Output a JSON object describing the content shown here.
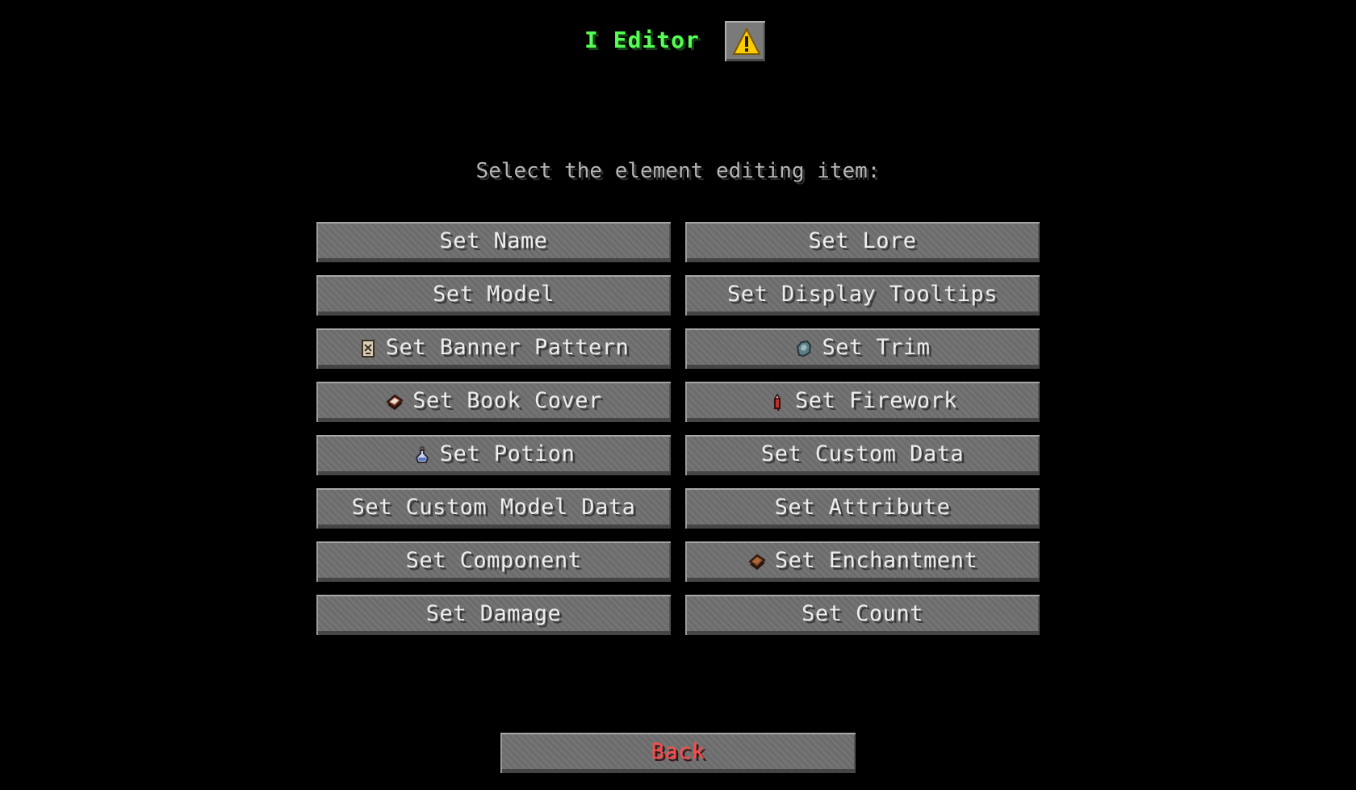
{
  "header": {
    "title": "I Editor",
    "warning_icon": "warning-icon"
  },
  "subtitle": "Select the element editing item:",
  "buttons": [
    {
      "label": "Set Name",
      "icon": null
    },
    {
      "label": "Set Lore",
      "icon": null
    },
    {
      "label": "Set Model",
      "icon": null
    },
    {
      "label": "Set Display Tooltips",
      "icon": null
    },
    {
      "label": "Set Banner Pattern",
      "icon": "banner-pattern-icon"
    },
    {
      "label": "Set Trim",
      "icon": "armor-trim-icon"
    },
    {
      "label": "Set Book Cover",
      "icon": "book-icon"
    },
    {
      "label": "Set Firework",
      "icon": "firework-rocket-icon"
    },
    {
      "label": "Set Potion",
      "icon": "potion-icon"
    },
    {
      "label": "Set Custom Data",
      "icon": null
    },
    {
      "label": "Set Custom Model Data",
      "icon": null
    },
    {
      "label": "Set Attribute",
      "icon": null
    },
    {
      "label": "Set Component",
      "icon": null
    },
    {
      "label": "Set Enchantment",
      "icon": "enchanted-book-icon"
    },
    {
      "label": "Set Damage",
      "icon": null
    },
    {
      "label": "Set Count",
      "icon": null
    }
  ],
  "back_button": {
    "label": "Back"
  },
  "colors": {
    "title": "#55ff55",
    "back_label": "#ff4b4b",
    "button_face": "#6f6f6f",
    "warning": "#ffcc00"
  }
}
